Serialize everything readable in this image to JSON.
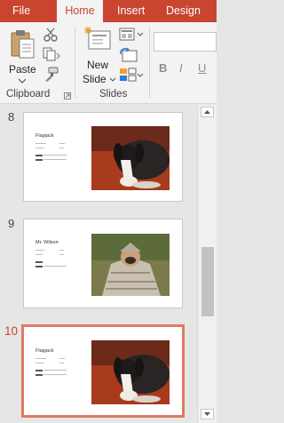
{
  "tabs": [
    {
      "label": "File",
      "active": false
    },
    {
      "label": "Home",
      "active": true
    },
    {
      "label": "Insert",
      "active": false
    },
    {
      "label": "Design",
      "active": false
    }
  ],
  "clipboard": {
    "paste_label": "Paste",
    "group_label": "Clipboard"
  },
  "slides_group": {
    "new_slide_line1": "New",
    "new_slide_line2": "Slide",
    "group_label": "Slides"
  },
  "font": {
    "bold": "B",
    "italic": "I",
    "underline": "U"
  },
  "thumbnails": [
    {
      "number": "8",
      "title": "Flapjack",
      "selected": false
    },
    {
      "number": "9",
      "title": "Mr. Wilson",
      "selected": false
    },
    {
      "number": "10",
      "title": "Flapjack",
      "selected": true
    }
  ],
  "colors": {
    "accent": "#c9452f",
    "selection_border": "#e07a5f"
  }
}
